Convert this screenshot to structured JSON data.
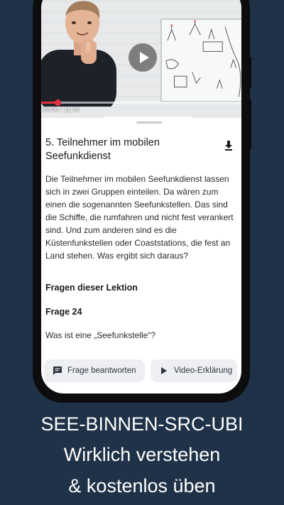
{
  "video": {
    "time_label": "00:56 / 11:16",
    "progress": 0.083
  },
  "lesson": {
    "title": "5. Teilnehmer im mobilen Seefunkdienst",
    "body": "Die Teilnehmer im mobilen Seefunkdienst lassen sich in zwei Gruppen einteilen. Da wären zum einen die sogenannten Seefunkstellen. Das sind die Schiffe, die rumfahren und nicht fest verankert sind. Und zum anderen sind es die Küstenfunkstellen oder Coaststations, die fest an Land stehen. Was ergibt sich daraus?"
  },
  "questions": {
    "heading": "Fragen dieser Lektion",
    "number": "Frage 24",
    "text": "Was ist eine „Seefunkstelle“?"
  },
  "actions": {
    "answer_label": "Frage beantworten",
    "video_label": "Video-Erklärung"
  },
  "caption": {
    "line1": "SEE-BINNEN-SRC-UBI",
    "line2": "Wirklich verstehen",
    "line3": "& kostenlos üben"
  },
  "colors": {
    "background": "#1f3248",
    "accent_red": "#e53140",
    "button_bg": "#eeeff2"
  }
}
